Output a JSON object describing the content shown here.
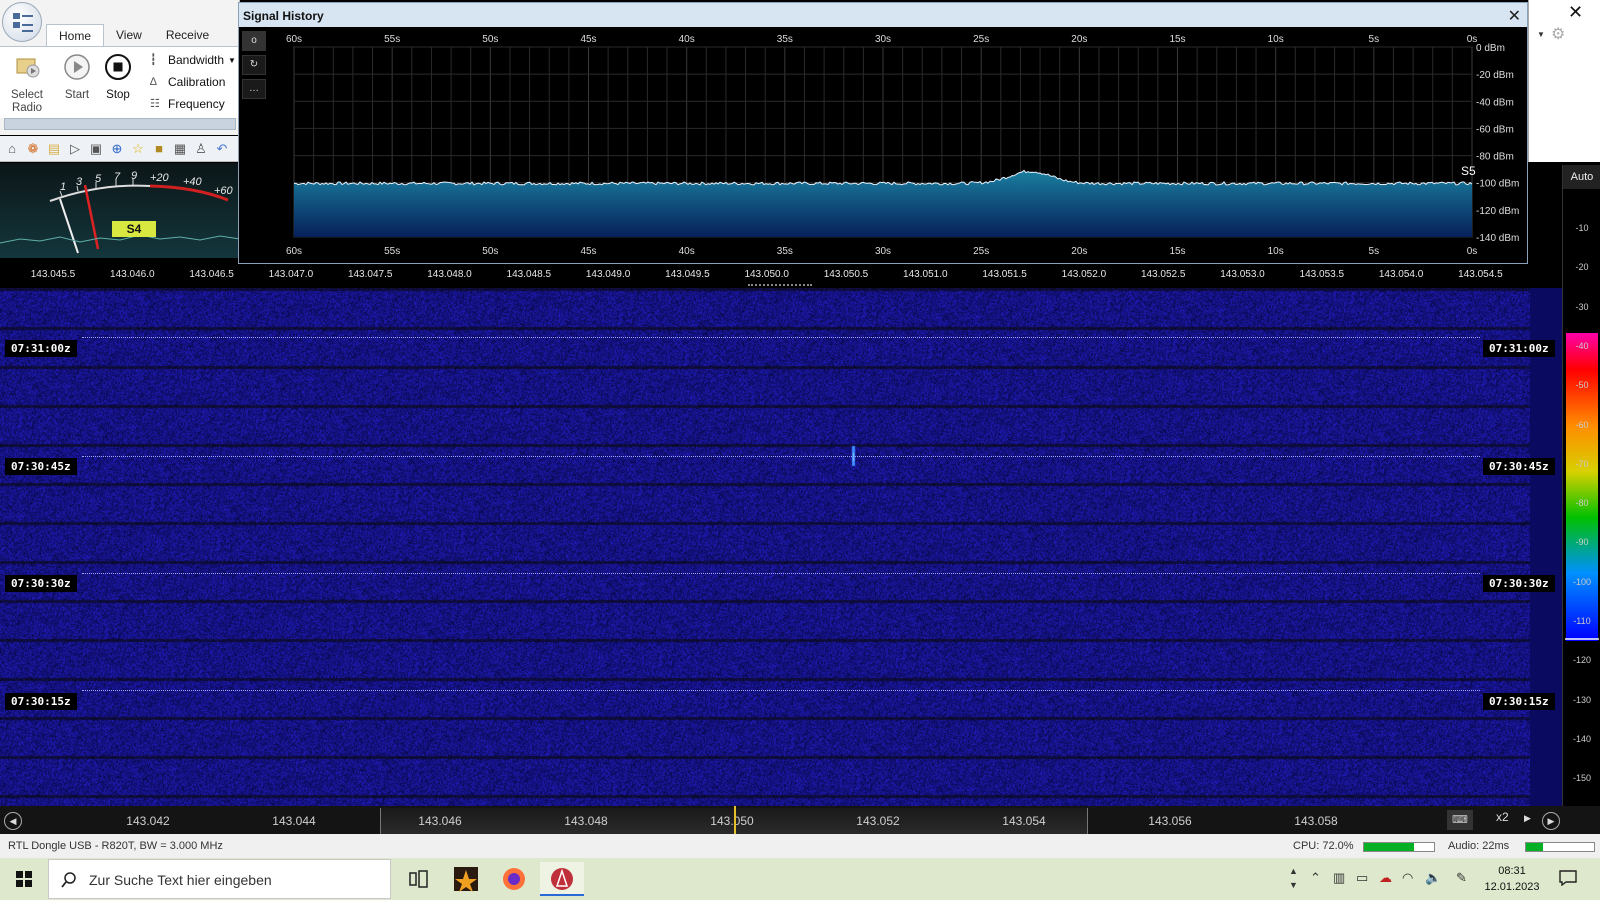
{
  "ribbon": {
    "tabs": [
      "Home",
      "View",
      "Receive"
    ],
    "select_radio": "Select Radio",
    "start": "Start",
    "stop": "Stop",
    "bandwidth": "Bandwidth",
    "calibration": "Calibration",
    "frequency": "Frequency"
  },
  "smeter": {
    "scale": [
      "1",
      "3",
      "5",
      "7",
      "9",
      "+20",
      "+40",
      "+60"
    ],
    "reading": "S4"
  },
  "signal_history": {
    "title": "Signal History",
    "time_labels": [
      "60s",
      "55s",
      "50s",
      "45s",
      "40s",
      "35s",
      "30s",
      "25s",
      "20s",
      "15s",
      "10s",
      "5s",
      "0s"
    ],
    "db_labels": [
      "0 dBm",
      "-20 dBm",
      "-40 dBm",
      "-60 dBm",
      "-80 dBm",
      "-100 dBm",
      "-120 dBm",
      "-140 dBm"
    ],
    "s_label": "S5",
    "tools": [
      "o",
      "↻",
      "…"
    ]
  },
  "freq_ruler": [
    "143.045.5",
    "143.046.0",
    "143.046.5",
    "143.047.0",
    "143.047.5",
    "143.048.0",
    "143.048.5",
    "143.049.0",
    "143.049.5",
    "143.050.0",
    "143.050.5",
    "143.051.0",
    "143.051.5",
    "143.052.0",
    "143.052.5",
    "143.053.0",
    "143.053.5",
    "143.054.0",
    "143.054.5"
  ],
  "waterfall": {
    "timestamps": [
      "07:31:00z",
      "07:30:45z",
      "07:30:30z",
      "07:30:15z"
    ]
  },
  "db_scale": {
    "auto": "Auto",
    "ticks": [
      "-10",
      "-20",
      "-30",
      "-40",
      "-50",
      "-60",
      "-70",
      "-80",
      "-90",
      "-100",
      "-110",
      "-120",
      "-130",
      "-140",
      "-150"
    ]
  },
  "bottom_freq": [
    "143.042",
    "143.044",
    "143.046",
    "143.048",
    "143.050",
    "143.052",
    "143.054",
    "143.056",
    "143.058"
  ],
  "zoom": "x2",
  "status": {
    "device": "RTL Dongle USB - R820T, BW = 3.000 MHz",
    "cpu": "CPU: 72.0%",
    "cpu_fraction": 0.72,
    "audio": "Audio: 22ms",
    "audio_fraction": 0.25
  },
  "taskbar": {
    "search_placeholder": "Zur Suche Text hier eingeben",
    "time": "08:31",
    "date": "12.01.2023"
  },
  "colors": {
    "waterfall_bg": "#0a0a60",
    "signal_fill": "#0e5fa8",
    "trace": "#e8f4ff",
    "cursor": "#e4c02a",
    "taskbar": "#dde8cc"
  }
}
